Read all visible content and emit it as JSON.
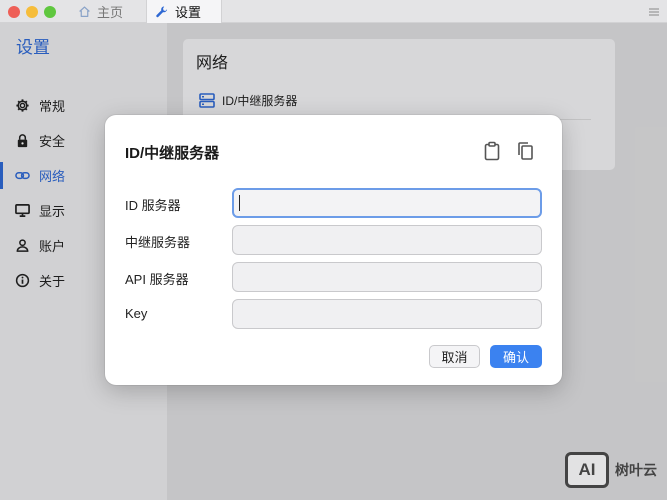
{
  "tabs": [
    {
      "label": "主页",
      "icon": "home-icon"
    },
    {
      "label": "设置",
      "icon": "wrench-icon"
    }
  ],
  "sidebar": {
    "title": "设置",
    "items": [
      {
        "label": "常规",
        "icon": "gear-icon"
      },
      {
        "label": "安全",
        "icon": "lock-icon"
      },
      {
        "label": "网络",
        "icon": "link-icon",
        "active": true
      },
      {
        "label": "显示",
        "icon": "monitor-icon"
      },
      {
        "label": "账户",
        "icon": "person-icon"
      },
      {
        "label": "关于",
        "icon": "info-icon"
      }
    ]
  },
  "main": {
    "card_title": "网络",
    "row_label": "ID/中继服务器"
  },
  "dialog": {
    "title": "ID/中继服务器",
    "fields": [
      {
        "label": "ID 服务器",
        "value": ""
      },
      {
        "label": "中继服务器",
        "value": ""
      },
      {
        "label": "API 服务器",
        "value": ""
      },
      {
        "label": "Key",
        "value": ""
      }
    ],
    "cancel_label": "取消",
    "ok_label": "确认"
  },
  "watermark": {
    "logo": "AI",
    "text": "树叶云"
  },
  "colors": {
    "accent": "#2e68d3",
    "primary_button": "#3b82f0",
    "focus_border": "#6c9ce8"
  }
}
